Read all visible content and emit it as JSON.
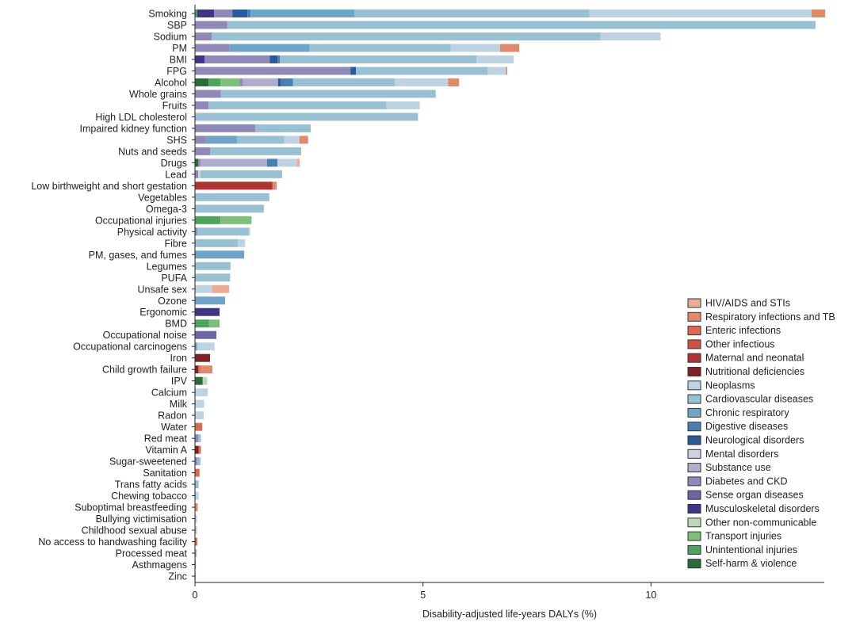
{
  "chart_data": {
    "type": "bar",
    "orientation": "horizontal-stacked",
    "xlabel": "Disability-adjusted life-years DALYs (%)",
    "xlim": [
      0,
      13.8
    ],
    "xticks": [
      0,
      5,
      10
    ],
    "grid": false,
    "legend_position": "bottom-right",
    "legend": [
      {
        "name": "HIV/AIDS and STIs",
        "color": "#e9ac96"
      },
      {
        "name": "Respiratory infections and TB",
        "color": "#e08a6c"
      },
      {
        "name": "Enteric infections",
        "color": "#d96b50"
      },
      {
        "name": "Other infectious",
        "color": "#cf5040"
      },
      {
        "name": "Maternal and neonatal",
        "color": "#b13232"
      },
      {
        "name": "Nutritional deficiencies",
        "color": "#7a2226"
      },
      {
        "name": "Neoplasms",
        "color": "#bdd3e2"
      },
      {
        "name": "Cardiovascular diseases",
        "color": "#98c0d2"
      },
      {
        "name": "Chronic respiratory",
        "color": "#6fa3c7"
      },
      {
        "name": "Digestive diseases",
        "color": "#4a7fb3"
      },
      {
        "name": "Neurological disorders",
        "color": "#2a5a97"
      },
      {
        "name": "Mental disorders",
        "color": "#cfd0e1"
      },
      {
        "name": "Substance use",
        "color": "#aeaecc"
      },
      {
        "name": "Diabetes and CKD",
        "color": "#8e89b6"
      },
      {
        "name": "Sense organ diseases",
        "color": "#6c66a6"
      },
      {
        "name": "Musculoskeletal disorders",
        "color": "#3e3585"
      },
      {
        "name": "Other non-communicable",
        "color": "#b8dab4"
      },
      {
        "name": "Transport injuries",
        "color": "#7dbf7a"
      },
      {
        "name": "Unintentional injuries",
        "color": "#4fa45d"
      },
      {
        "name": "Self-harm & violence",
        "color": "#2b6b3a"
      }
    ],
    "bars": [
      {
        "label": "Smoking",
        "segments": [
          [
            "Unintentional injuries",
            0.05
          ],
          [
            "Musculoskeletal disorders",
            0.37
          ],
          [
            "Diabetes and CKD",
            0.4
          ],
          [
            "Neurological disorders",
            0.33
          ],
          [
            "Digestive diseases",
            0.07
          ],
          [
            "Chronic respiratory",
            2.28
          ],
          [
            "Cardiovascular diseases",
            5.15
          ],
          [
            "Neoplasms",
            4.87
          ],
          [
            "Respiratory infections and TB",
            0.3
          ]
        ]
      },
      {
        "label": "SBP",
        "segments": [
          [
            "Diabetes and CKD",
            0.71
          ],
          [
            "Cardiovascular diseases",
            12.9
          ]
        ]
      },
      {
        "label": "Sodium",
        "segments": [
          [
            "Diabetes and CKD",
            0.37
          ],
          [
            "Cardiovascular diseases",
            8.52
          ],
          [
            "Neoplasms",
            1.32
          ]
        ]
      },
      {
        "label": "PM",
        "segments": [
          [
            "Diabetes and CKD",
            0.75
          ],
          [
            "Chronic respiratory",
            1.76
          ],
          [
            "Cardiovascular diseases",
            3.1
          ],
          [
            "Neoplasms",
            1.08
          ],
          [
            "Respiratory infections and TB",
            0.42
          ]
        ]
      },
      {
        "label": "BMI",
        "segments": [
          [
            "Musculoskeletal disorders",
            0.21
          ],
          [
            "Diabetes and CKD",
            1.43
          ],
          [
            "Neurological disorders",
            0.17
          ],
          [
            "Digestive diseases",
            0.05
          ],
          [
            "Cardiovascular diseases",
            4.31
          ],
          [
            "Neoplasms",
            0.82
          ]
        ]
      },
      {
        "label": "FPG",
        "segments": [
          [
            "Diabetes and CKD",
            3.41
          ],
          [
            "Neurological disorders",
            0.12
          ],
          [
            "Cardiovascular diseases",
            2.89
          ],
          [
            "Neoplasms",
            0.4
          ],
          [
            "Respiratory infections and TB",
            0.03
          ]
        ]
      },
      {
        "label": "Alcohol",
        "segments": [
          [
            "Self-harm & violence",
            0.3
          ],
          [
            "Unintentional injuries",
            0.26
          ],
          [
            "Transport injuries",
            0.42
          ],
          [
            "Diabetes and CKD",
            0.07
          ],
          [
            "Substance use",
            0.77
          ],
          [
            "Neurological disorders",
            0.07
          ],
          [
            "Digestive diseases",
            0.26
          ],
          [
            "Cardiovascular diseases",
            2.23
          ],
          [
            "Neoplasms",
            1.17
          ],
          [
            "Respiratory infections and TB",
            0.24
          ]
        ]
      },
      {
        "label": "Whole grains",
        "segments": [
          [
            "Diabetes and CKD",
            0.57
          ],
          [
            "Cardiovascular diseases",
            4.71
          ]
        ]
      },
      {
        "label": "Fruits",
        "segments": [
          [
            "Diabetes and CKD",
            0.3
          ],
          [
            "Cardiovascular diseases",
            3.9
          ],
          [
            "Neoplasms",
            0.73
          ]
        ]
      },
      {
        "label": "High LDL cholesterol",
        "segments": [
          [
            "Cardiovascular diseases",
            4.89
          ]
        ]
      },
      {
        "label": "Impaired kidney function",
        "segments": [
          [
            "Diabetes and CKD",
            1.32
          ],
          [
            "Cardiovascular diseases",
            1.22
          ]
        ]
      },
      {
        "label": "SHS",
        "segments": [
          [
            "Diabetes and CKD",
            0.24
          ],
          [
            "Chronic respiratory",
            0.68
          ],
          [
            "Cardiovascular diseases",
            1.04
          ],
          [
            "Neoplasms",
            0.33
          ],
          [
            "Respiratory infections and TB",
            0.19
          ]
        ]
      },
      {
        "label": "Nuts and seeds",
        "segments": [
          [
            "Diabetes and CKD",
            0.33
          ],
          [
            "Cardiovascular diseases",
            2.0
          ]
        ]
      },
      {
        "label": "Drugs",
        "segments": [
          [
            "Self-harm & violence",
            0.07
          ],
          [
            "Diabetes and CKD",
            0.05
          ],
          [
            "Substance use",
            1.46
          ],
          [
            "Digestive diseases",
            0.23
          ],
          [
            "Neoplasms",
            0.42
          ],
          [
            "HIV/AIDS and STIs",
            0.07
          ]
        ]
      },
      {
        "label": "Lead",
        "segments": [
          [
            "Diabetes and CKD",
            0.07
          ],
          [
            "Mental disorders",
            0.05
          ],
          [
            "Cardiovascular diseases",
            1.79
          ]
        ]
      },
      {
        "label": "Low birthweight and short gestation",
        "segments": [
          [
            "Maternal and neonatal",
            1.7
          ],
          [
            "Respiratory infections and TB",
            0.09
          ]
        ]
      },
      {
        "label": "Vegetables",
        "segments": [
          [
            "Cardiovascular diseases",
            1.63
          ]
        ]
      },
      {
        "label": "Omega-3",
        "segments": [
          [
            "Cardiovascular diseases",
            1.51
          ]
        ]
      },
      {
        "label": "Occupational injuries",
        "segments": [
          [
            "Unintentional injuries",
            0.56
          ],
          [
            "Transport injuries",
            0.68
          ]
        ]
      },
      {
        "label": "Physical activity",
        "segments": [
          [
            "Diabetes and CKD",
            0.05
          ],
          [
            "Cardiovascular diseases",
            1.13
          ],
          [
            "Neoplasms",
            0.03
          ]
        ]
      },
      {
        "label": "Fibre",
        "segments": [
          [
            "Cardiovascular diseases",
            0.94
          ],
          [
            "Neoplasms",
            0.16
          ]
        ]
      },
      {
        "label": "PM, gases, and fumes",
        "segments": [
          [
            "Chronic respiratory",
            1.08
          ]
        ]
      },
      {
        "label": "Legumes",
        "segments": [
          [
            "Cardiovascular diseases",
            0.78
          ]
        ]
      },
      {
        "label": "PUFA",
        "segments": [
          [
            "Cardiovascular diseases",
            0.77
          ]
        ]
      },
      {
        "label": "Unsafe sex",
        "segments": [
          [
            "Neoplasms",
            0.37
          ],
          [
            "HIV/AIDS and STIs",
            0.38
          ]
        ]
      },
      {
        "label": "Ozone",
        "segments": [
          [
            "Chronic respiratory",
            0.66
          ]
        ]
      },
      {
        "label": "Ergonomic",
        "segments": [
          [
            "Musculoskeletal disorders",
            0.54
          ]
        ]
      },
      {
        "label": "BMD",
        "segments": [
          [
            "Unintentional injuries",
            0.31
          ],
          [
            "Transport injuries",
            0.23
          ]
        ]
      },
      {
        "label": "Occupational noise",
        "segments": [
          [
            "Sense organ diseases",
            0.47
          ]
        ]
      },
      {
        "label": "Occupational carcinogens",
        "segments": [
          [
            "Chronic respiratory",
            0.05
          ],
          [
            "Neoplasms",
            0.38
          ]
        ]
      },
      {
        "label": "Iron",
        "segments": [
          [
            "Nutritional deficiencies",
            0.33
          ]
        ]
      },
      {
        "label": "Child growth failure",
        "segments": [
          [
            "Nutritional deficiencies",
            0.07
          ],
          [
            "Enteric infections",
            0.05
          ],
          [
            "Respiratory infections and TB",
            0.26
          ]
        ]
      },
      {
        "label": "IPV",
        "segments": [
          [
            "Self-harm & violence",
            0.17
          ],
          [
            "Other non-communicable",
            0.1
          ]
        ]
      },
      {
        "label": "Calcium",
        "segments": [
          [
            "Neoplasms",
            0.28
          ]
        ]
      },
      {
        "label": "Milk",
        "segments": [
          [
            "Neoplasms",
            0.2
          ]
        ]
      },
      {
        "label": "Radon",
        "segments": [
          [
            "Neoplasms",
            0.19
          ]
        ]
      },
      {
        "label": "Water",
        "segments": [
          [
            "Enteric infections",
            0.16
          ]
        ]
      },
      {
        "label": "Red meat",
        "segments": [
          [
            "Diabetes and CKD",
            0.07
          ],
          [
            "Cardiovascular diseases",
            0.06
          ]
        ]
      },
      {
        "label": "Vitamin A",
        "segments": [
          [
            "Nutritional deficiencies",
            0.08
          ],
          [
            "Enteric infections",
            0.05
          ]
        ]
      },
      {
        "label": "Sugar-sweetened",
        "segments": [
          [
            "Diabetes and CKD",
            0.05
          ],
          [
            "Cardiovascular diseases",
            0.07
          ]
        ]
      },
      {
        "label": "Sanitation",
        "segments": [
          [
            "Enteric infections",
            0.1
          ]
        ]
      },
      {
        "label": "Trans fatty acids",
        "segments": [
          [
            "Cardiovascular diseases",
            0.08
          ]
        ]
      },
      {
        "label": "Chewing tobacco",
        "segments": [
          [
            "Neoplasms",
            0.08
          ]
        ]
      },
      {
        "label": "Suboptimal breastfeeding",
        "segments": [
          [
            "Respiratory infections and TB",
            0.06
          ]
        ]
      },
      {
        "label": "Bullying victimisation",
        "segments": [
          [
            "Mental disorders",
            0.05
          ]
        ]
      },
      {
        "label": "Childhood sexual abuse",
        "segments": [
          [
            "Mental disorders",
            0.05
          ]
        ]
      },
      {
        "label": "No access to handwashing facility",
        "segments": [
          [
            "Enteric infections",
            0.05
          ]
        ]
      },
      {
        "label": "Processed meat",
        "segments": [
          [
            "Cardiovascular diseases",
            0.04
          ]
        ]
      },
      {
        "label": "Asthmagens",
        "segments": [
          [
            "Chronic respiratory",
            0.02
          ]
        ]
      },
      {
        "label": "Zinc",
        "segments": [
          [
            "Enteric infections",
            0.01
          ]
        ]
      }
    ]
  }
}
